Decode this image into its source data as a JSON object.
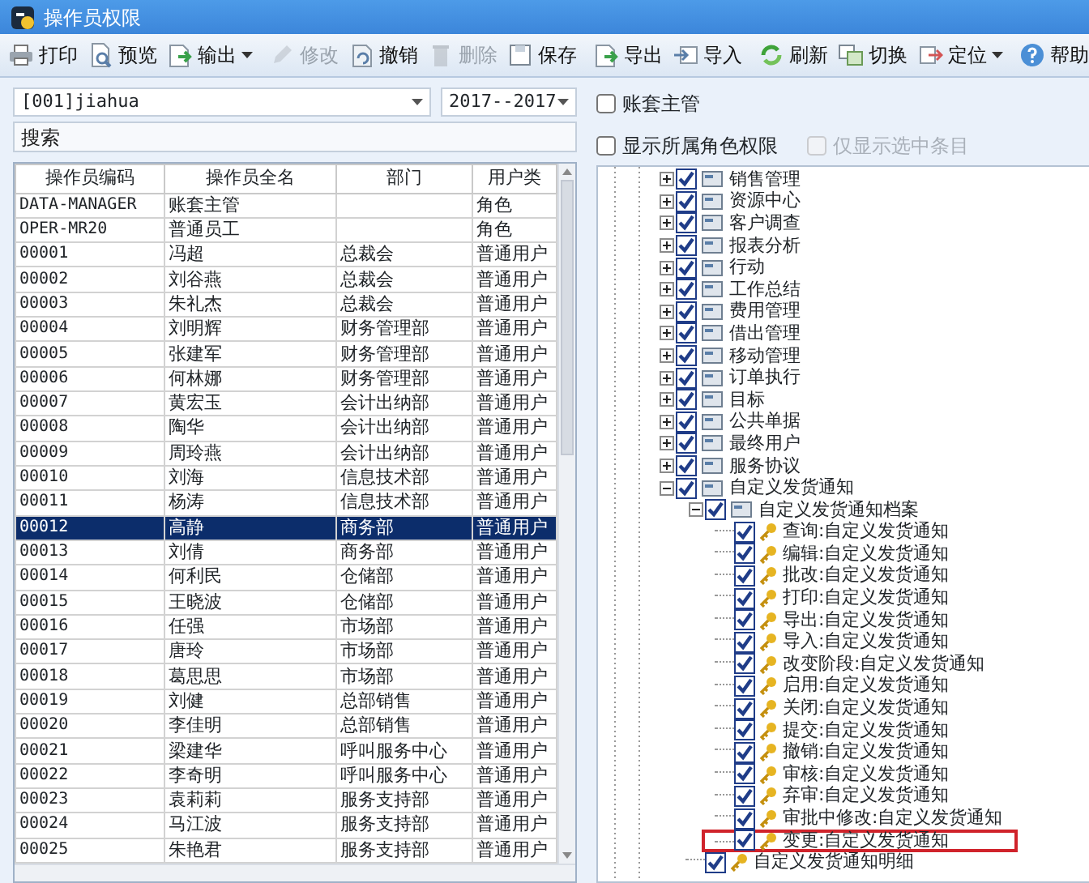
{
  "window": {
    "title": "操作员权限"
  },
  "toolbar": [
    {
      "kind": "button",
      "label": "打印",
      "disabled": false,
      "has_menu": false
    },
    {
      "kind": "button",
      "label": "预览",
      "disabled": false,
      "has_menu": false
    },
    {
      "kind": "button",
      "label": "输出",
      "disabled": false,
      "has_menu": true
    },
    {
      "kind": "separator"
    },
    {
      "kind": "button",
      "label": "修改",
      "disabled": true,
      "has_menu": false
    },
    {
      "kind": "button",
      "label": "撤销",
      "disabled": false,
      "has_menu": false
    },
    {
      "kind": "button",
      "label": "删除",
      "disabled": true,
      "has_menu": false
    },
    {
      "kind": "button",
      "label": "保存",
      "disabled": false,
      "has_menu": false
    },
    {
      "kind": "separator"
    },
    {
      "kind": "button",
      "label": "导出",
      "disabled": false,
      "has_menu": false
    },
    {
      "kind": "button",
      "label": "导入",
      "disabled": false,
      "has_menu": false
    },
    {
      "kind": "separator"
    },
    {
      "kind": "button",
      "label": "刷新",
      "disabled": false,
      "has_menu": false
    },
    {
      "kind": "button",
      "label": "切换",
      "disabled": false,
      "has_menu": false
    },
    {
      "kind": "button",
      "label": "定位",
      "disabled": false,
      "has_menu": true
    },
    {
      "kind": "separator"
    },
    {
      "kind": "button",
      "label": "帮助",
      "disabled": false,
      "has_menu": false
    }
  ],
  "filters": {
    "account": {
      "value": "[001]jiahua"
    },
    "year": {
      "value": "2017--2017"
    }
  },
  "search": {
    "placeholder": "搜索"
  },
  "operator_table": {
    "columns": [
      "操作员编码",
      "操作员全名",
      "部门",
      "用户类"
    ],
    "rows": [
      {
        "cells": [
          "DATA-MANAGER",
          "账套主管",
          "",
          "角色"
        ],
        "selected": false
      },
      {
        "cells": [
          "OPER-MR20",
          "普通员工",
          "",
          "角色"
        ],
        "selected": false
      },
      {
        "cells": [
          "00001",
          "冯超",
          "总裁会",
          "普通用户"
        ],
        "selected": false
      },
      {
        "cells": [
          "00002",
          "刘谷燕",
          "总裁会",
          "普通用户"
        ],
        "selected": false
      },
      {
        "cells": [
          "00003",
          "朱礼杰",
          "总裁会",
          "普通用户"
        ],
        "selected": false
      },
      {
        "cells": [
          "00004",
          "刘明辉",
          "财务管理部",
          "普通用户"
        ],
        "selected": false
      },
      {
        "cells": [
          "00005",
          "张建军",
          "财务管理部",
          "普通用户"
        ],
        "selected": false
      },
      {
        "cells": [
          "00006",
          "何林娜",
          "财务管理部",
          "普通用户"
        ],
        "selected": false
      },
      {
        "cells": [
          "00007",
          "黄宏玉",
          "会计出纳部",
          "普通用户"
        ],
        "selected": false
      },
      {
        "cells": [
          "00008",
          "陶华",
          "会计出纳部",
          "普通用户"
        ],
        "selected": false
      },
      {
        "cells": [
          "00009",
          "周玲燕",
          "会计出纳部",
          "普通用户"
        ],
        "selected": false
      },
      {
        "cells": [
          "00010",
          "刘海",
          "信息技术部",
          "普通用户"
        ],
        "selected": false
      },
      {
        "cells": [
          "00011",
          "杨涛",
          "信息技术部",
          "普通用户"
        ],
        "selected": false
      },
      {
        "cells": [
          "00012",
          "高静",
          "商务部",
          "普通用户"
        ],
        "selected": true
      },
      {
        "cells": [
          "00013",
          "刘倩",
          "商务部",
          "普通用户"
        ],
        "selected": false
      },
      {
        "cells": [
          "00014",
          "何利民",
          "仓储部",
          "普通用户"
        ],
        "selected": false
      },
      {
        "cells": [
          "00015",
          "王晓波",
          "仓储部",
          "普通用户"
        ],
        "selected": false
      },
      {
        "cells": [
          "00016",
          "任强",
          "市场部",
          "普通用户"
        ],
        "selected": false
      },
      {
        "cells": [
          "00017",
          "唐玲",
          "市场部",
          "普通用户"
        ],
        "selected": false
      },
      {
        "cells": [
          "00018",
          "葛思思",
          "市场部",
          "普通用户"
        ],
        "selected": false
      },
      {
        "cells": [
          "00019",
          "刘健",
          "总部销售",
          "普通用户"
        ],
        "selected": false
      },
      {
        "cells": [
          "00020",
          "李佳明",
          "总部销售",
          "普通用户"
        ],
        "selected": false
      },
      {
        "cells": [
          "00021",
          "梁建华",
          "呼叫服务中心",
          "普通用户"
        ],
        "selected": false
      },
      {
        "cells": [
          "00022",
          "李奇明",
          "呼叫服务中心",
          "普通用户"
        ],
        "selected": false
      },
      {
        "cells": [
          "00023",
          "袁莉莉",
          "服务支持部",
          "普通用户"
        ],
        "selected": false
      },
      {
        "cells": [
          "00024",
          "马江波",
          "服务支持部",
          "普通用户"
        ],
        "selected": false
      },
      {
        "cells": [
          "00025",
          "朱艳君",
          "服务支持部",
          "普通用户"
        ],
        "selected": false
      }
    ]
  },
  "options": [
    {
      "label": "账套主管",
      "checked": false,
      "disabled": false
    },
    {
      "label": "显示所属角色权限",
      "checked": false,
      "disabled": false
    },
    {
      "label": "仅显示选中条目",
      "checked": false,
      "disabled": true
    }
  ],
  "permission_tree": [
    {
      "kind": "module",
      "label": "销售管理",
      "checked": true,
      "expanded": false
    },
    {
      "kind": "module",
      "label": "资源中心",
      "checked": true,
      "expanded": false
    },
    {
      "kind": "module",
      "label": "客户调查",
      "checked": true,
      "expanded": false
    },
    {
      "kind": "module",
      "label": "报表分析",
      "checked": true,
      "expanded": false
    },
    {
      "kind": "module",
      "label": "行动",
      "checked": true,
      "expanded": false
    },
    {
      "kind": "module",
      "label": "工作总结",
      "checked": true,
      "expanded": false
    },
    {
      "kind": "module",
      "label": "费用管理",
      "checked": true,
      "expanded": false
    },
    {
      "kind": "module",
      "label": "借出管理",
      "checked": true,
      "expanded": false
    },
    {
      "kind": "module",
      "label": "移动管理",
      "checked": true,
      "expanded": false
    },
    {
      "kind": "module",
      "label": "订单执行",
      "checked": true,
      "expanded": false
    },
    {
      "kind": "module",
      "label": "目标",
      "checked": true,
      "expanded": false
    },
    {
      "kind": "module",
      "label": "公共单据",
      "checked": true,
      "expanded": false
    },
    {
      "kind": "module",
      "label": "最终用户",
      "checked": true,
      "expanded": false
    },
    {
      "kind": "module",
      "label": "服务协议",
      "checked": true,
      "expanded": false
    },
    {
      "kind": "module",
      "label": "自定义发货通知",
      "checked": true,
      "expanded": true,
      "children": [
        {
          "kind": "module",
          "label": "自定义发货通知档案",
          "checked": true,
          "expanded": true,
          "children": [
            {
              "kind": "permission",
              "label": "查询:自定义发货通知",
              "checked": true,
              "highlighted": false
            },
            {
              "kind": "permission",
              "label": "编辑:自定义发货通知",
              "checked": true,
              "highlighted": false
            },
            {
              "kind": "permission",
              "label": "批改:自定义发货通知",
              "checked": true,
              "highlighted": false
            },
            {
              "kind": "permission",
              "label": "打印:自定义发货通知",
              "checked": true,
              "highlighted": false
            },
            {
              "kind": "permission",
              "label": "导出:自定义发货通知",
              "checked": true,
              "highlighted": false
            },
            {
              "kind": "permission",
              "label": "导入:自定义发货通知",
              "checked": true,
              "highlighted": false
            },
            {
              "kind": "permission",
              "label": "改变阶段:自定义发货通知",
              "checked": true,
              "highlighted": false
            },
            {
              "kind": "permission",
              "label": "启用:自定义发货通知",
              "checked": true,
              "highlighted": false
            },
            {
              "kind": "permission",
              "label": "关闭:自定义发货通知",
              "checked": true,
              "highlighted": false
            },
            {
              "kind": "permission",
              "label": "提交:自定义发货通知",
              "checked": true,
              "highlighted": false
            },
            {
              "kind": "permission",
              "label": "撤销:自定义发货通知",
              "checked": true,
              "highlighted": false
            },
            {
              "kind": "permission",
              "label": "审核:自定义发货通知",
              "checked": true,
              "highlighted": false
            },
            {
              "kind": "permission",
              "label": "弃审:自定义发货通知",
              "checked": true,
              "highlighted": false
            },
            {
              "kind": "permission",
              "label": "审批中修改:自定义发货通知",
              "checked": true,
              "highlighted": false
            },
            {
              "kind": "permission",
              "label": "变更:自定义发货通知",
              "checked": true,
              "highlighted": true
            }
          ]
        },
        {
          "kind": "permission",
          "label": "自定义发货通知明细",
          "checked": true
        }
      ]
    }
  ]
}
